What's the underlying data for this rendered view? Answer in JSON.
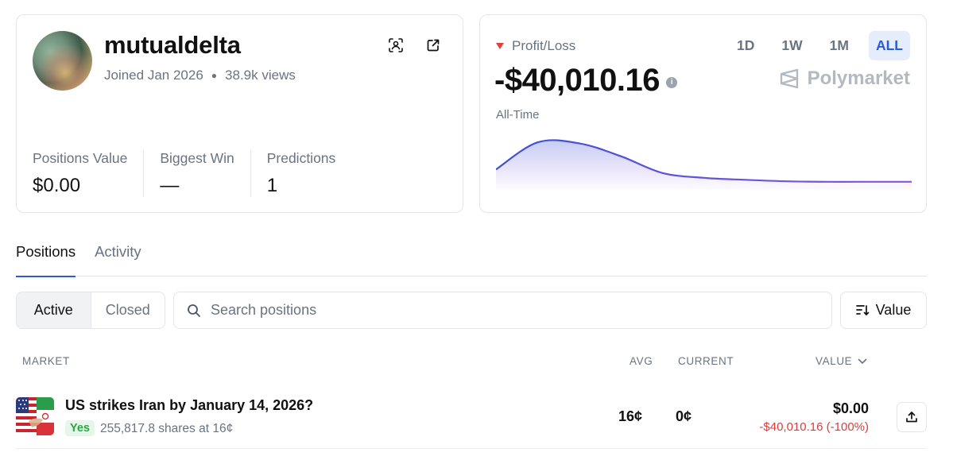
{
  "profile": {
    "username": "mutualdelta",
    "joined": "Joined Jan 2026",
    "views": "38.9k views",
    "stats": [
      {
        "label": "Positions Value",
        "value": "$0.00"
      },
      {
        "label": "Biggest Win",
        "value": "—"
      },
      {
        "label": "Predictions",
        "value": "1"
      }
    ]
  },
  "pnl": {
    "label": "Profit/Loss",
    "value": "-$40,010.16",
    "period": "All-Time",
    "ranges": [
      "1D",
      "1W",
      "1M",
      "ALL"
    ],
    "active_range": "ALL",
    "brand": "Polymarket",
    "colors": {
      "down": "#e2413a",
      "line_start": "#3b4fd6",
      "line_end": "#8a55e0"
    }
  },
  "chart_data": {
    "type": "area",
    "title": "",
    "xlabel": "",
    "ylabel": "",
    "series": [
      {
        "values": [
          0.35,
          0.9,
          0.88,
          0.62,
          0.28,
          0.18,
          0.14,
          0.11,
          0.1,
          0.1,
          0.1
        ]
      }
    ]
  },
  "tabs": [
    "Positions",
    "Activity"
  ],
  "filters": {
    "active": "Active",
    "closed": "Closed"
  },
  "search": {
    "placeholder": "Search positions"
  },
  "sort": {
    "label": "Value"
  },
  "table": {
    "headers": {
      "market": "MARKET",
      "avg": "AVG",
      "current": "CURRENT",
      "value": "VALUE"
    },
    "rows": [
      {
        "title": "US strikes Iran by January 14, 2026?",
        "outcome": "Yes",
        "shares": "255,817.8 shares at 16¢",
        "avg": "16¢",
        "current": "0¢",
        "value": "$0.00",
        "change": "-$40,010.16 (-100%)"
      }
    ]
  }
}
